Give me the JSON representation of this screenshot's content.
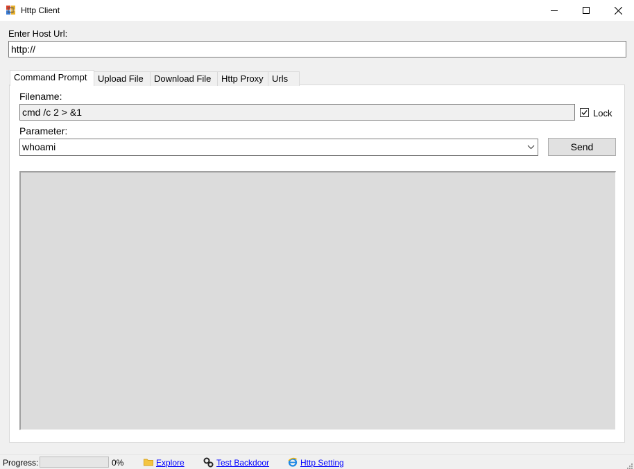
{
  "window": {
    "title": "Http Client",
    "icon": "app-icon",
    "controls": [
      "minimize-icon",
      "maximize-icon",
      "close-icon"
    ]
  },
  "host": {
    "label": "Enter Host Url:",
    "value": "http://"
  },
  "tabs": [
    {
      "label": "Command Prompt",
      "active": true
    },
    {
      "label": "Upload File",
      "active": false
    },
    {
      "label": "Download File",
      "active": false
    },
    {
      "label": "Http Proxy",
      "active": false
    },
    {
      "label": "Urls",
      "active": false
    }
  ],
  "command": {
    "filename_label": "Filename:",
    "filename_value": "cmd /c  2 > &1",
    "lock_label": "Lock",
    "lock_checked": true,
    "parameter_label": "Parameter:",
    "parameter_value": "whoami",
    "send_label": "Send",
    "output": ""
  },
  "status": {
    "progress_label": "Progress:",
    "progress_value": 0,
    "progress_text": "0%",
    "explore_label": "Explore",
    "test_backdoor_label": "Test Backdoor",
    "http_setting_label": "Http Setting",
    "icons": [
      "folder-icon",
      "gears-icon",
      "ie-icon"
    ]
  },
  "colors": {
    "link": "#0000ff",
    "window_bg": "#f0f0f0",
    "output_bg": "#dcdcdc"
  }
}
